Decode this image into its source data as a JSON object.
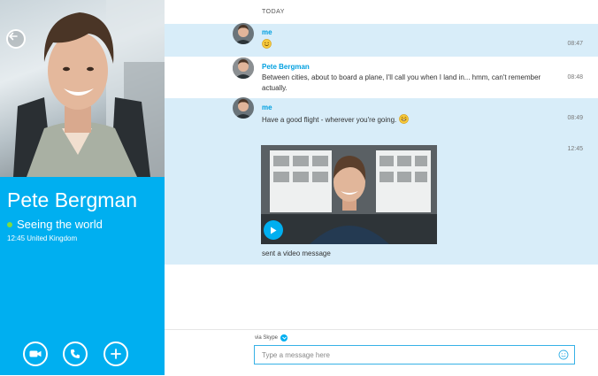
{
  "contact": {
    "name": "Pete Bergman",
    "mood": "Seeing the world",
    "local_info": "12:45 United Kingdom"
  },
  "chat": {
    "day_separator": "TODAY",
    "messages": [
      {
        "sender": "me",
        "text": "",
        "emoji": "smile-emoji",
        "time": "08:47",
        "own": true
      },
      {
        "sender": "Pete Bergman",
        "text": "Between cities, about to board a plane, I'll call you when I land in... hmm, can't remember actually.",
        "time": "08:48",
        "own": false
      },
      {
        "sender": "me",
        "text": "Have a good flight - wherever you're going.",
        "emoji": "grin-emoji",
        "time": "08:49",
        "own": true
      },
      {
        "sender": "",
        "text": "sent a video message",
        "time": "12:45",
        "own": true
      }
    ],
    "video_caption": "sent a video message"
  },
  "compose": {
    "via_label": "via Skype",
    "placeholder": "Type a message here"
  },
  "colors": {
    "accent": "#00aff0",
    "own_bubble": "#d8edf9",
    "presence": "#7fdc3f"
  },
  "icons": [
    "back-arrow-icon",
    "video-call-icon",
    "audio-call-icon",
    "add-icon",
    "play-icon",
    "emoticon-icon",
    "chevron-down-icon"
  ]
}
